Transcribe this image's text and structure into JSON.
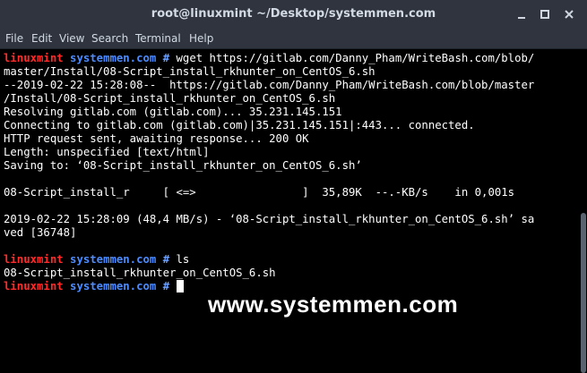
{
  "window": {
    "title": "root@linuxmint ~/Desktop/systemmen.com",
    "minimize_icon": "minimize-icon",
    "maximize_icon": "maximize-icon",
    "close_icon": "close-icon"
  },
  "menu": {
    "file": "File",
    "edit": "Edit",
    "view": "View",
    "search": "Search",
    "terminal": "Terminal",
    "help": "Help"
  },
  "prompt": {
    "user": "linuxmint",
    "host": "systemmen.com",
    "symbol": "#"
  },
  "terminal": {
    "cmd1": " wget https://gitlab.com/Danny_Pham/WriteBash.com/blob/",
    "line2": "master/Install/08-Script_install_rkhunter_on_CentOS_6.sh",
    "line3": "--2019-02-22 15:28:08--  https://gitlab.com/Danny_Pham/WriteBash.com/blob/master",
    "line4": "/Install/08-Script_install_rkhunter_on_CentOS_6.sh",
    "line5": "Resolving gitlab.com (gitlab.com)... 35.231.145.151",
    "line6": "Connecting to gitlab.com (gitlab.com)|35.231.145.151|:443... connected.",
    "line7": "HTTP request sent, awaiting response... 200 OK",
    "line8": "Length: unspecified [text/html]",
    "line9": "Saving to: ‘08-Script_install_rkhunter_on_CentOS_6.sh’",
    "line10": "08-Script_install_r     [ <=>                ]  35,89K  --.-KB/s    in 0,001s",
    "line11": "2019-02-22 15:28:09 (48,4 MB/s) - ‘08-Script_install_rkhunter_on_CentOS_6.sh’ sa",
    "line12": "ved [36748]",
    "cmd2": " ls",
    "line14": "08-Script_install_rkhunter_on_CentOS_6.sh"
  },
  "watermark": "www.systemmen.com"
}
